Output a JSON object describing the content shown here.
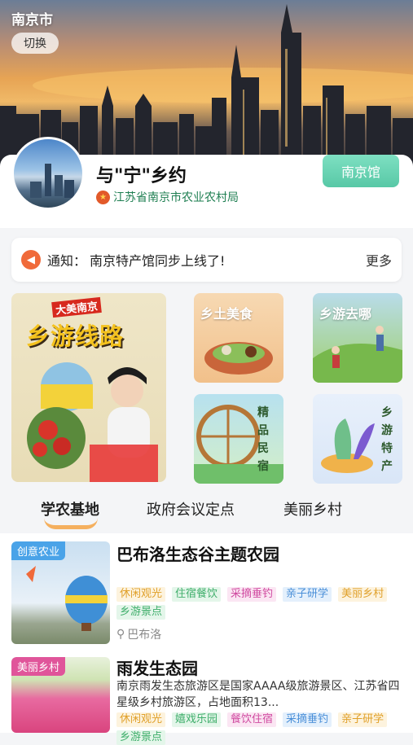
{
  "header": {
    "city": "南京市",
    "switch_label": "切换"
  },
  "profile": {
    "title": "与\"宁\"乡约",
    "org": "江苏省南京市农业农村局",
    "org_icon": "emblem-icon",
    "pavilion_button": "南京馆"
  },
  "notice": {
    "label": "通知：",
    "text": "南京特产馆同步上线了!",
    "more": "更多"
  },
  "tiles": {
    "big": {
      "subtitle": "大美南京",
      "title": "乡游线路"
    },
    "food": {
      "title": "乡土美食"
    },
    "where": {
      "title": "乡游去哪"
    },
    "homestay": {
      "title": "精品民宿"
    },
    "specialty": {
      "title": "乡游特产"
    }
  },
  "tabs": [
    {
      "label": "学农基地",
      "active": true
    },
    {
      "label": "政府会议定点",
      "active": false
    },
    {
      "label": "美丽乡村",
      "active": false
    }
  ],
  "items": [
    {
      "badge": "创意农业",
      "title": "巴布洛生态谷主题农园",
      "tags": [
        "休闲观光",
        "住宿餐饮",
        "采摘垂钓",
        "亲子研学",
        "美丽乡村",
        "乡游景点"
      ],
      "location": "巴布洛"
    },
    {
      "badge": "美丽乡村",
      "title": "雨发生态园",
      "description": "南京雨发生态旅游区是国家AAAA级旅游景区、江苏省四星级乡村旅游区，占地面积13...",
      "tags": [
        "休闲观光",
        "嬉戏乐园",
        "餐饮住宿",
        "采摘垂钓",
        "亲子研学",
        "乡游景点"
      ]
    }
  ],
  "colors": {
    "accent": "#58c8a6",
    "tab_underline": "#f6a03a",
    "notice_icon": "#f06a3a"
  }
}
